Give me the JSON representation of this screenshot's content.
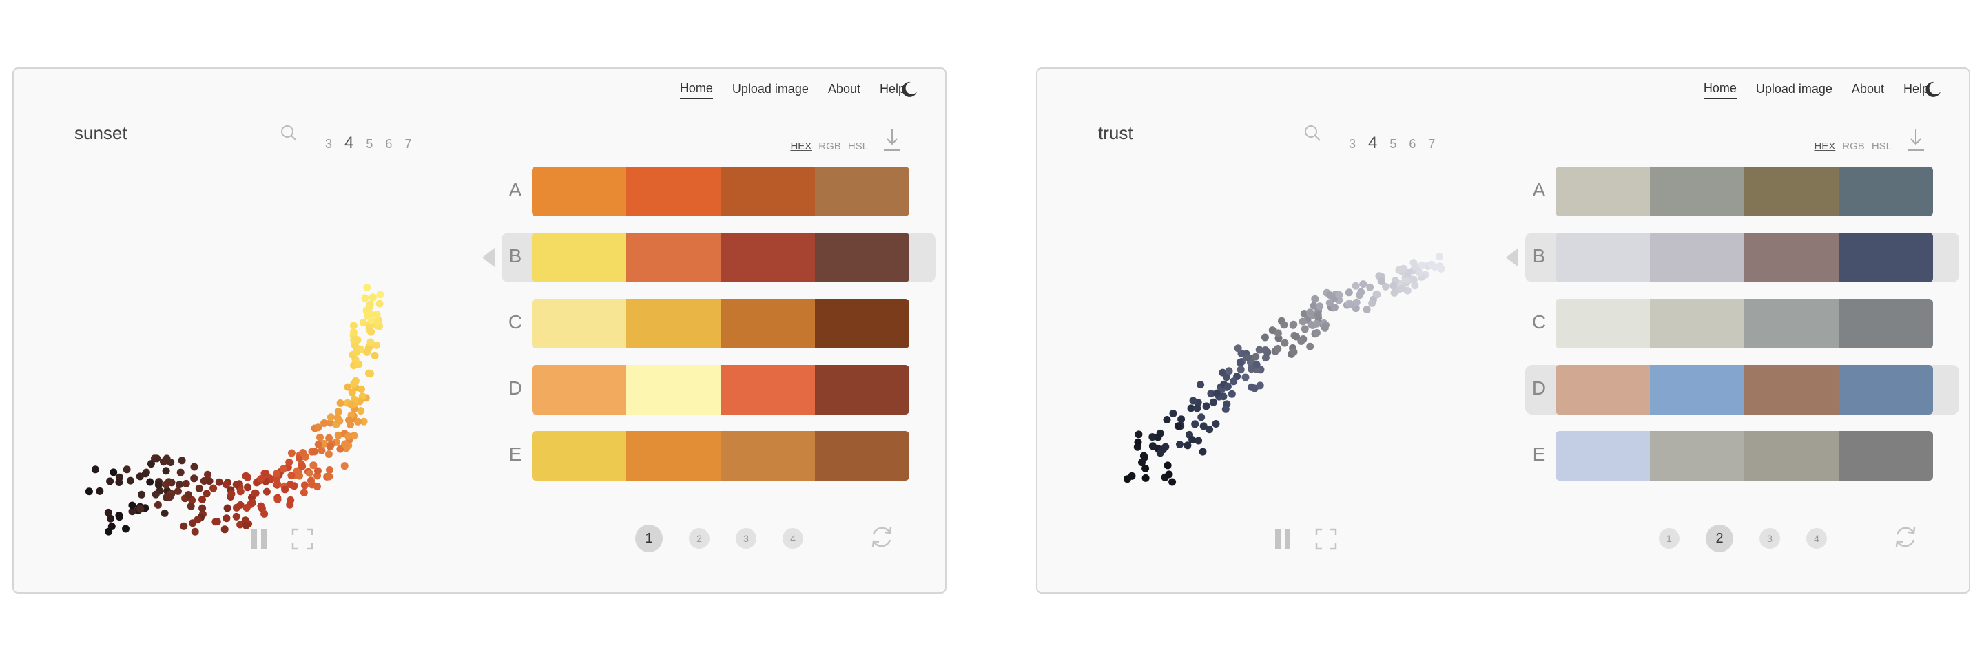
{
  "nav": [
    "Home",
    "Upload image",
    "About",
    "Help"
  ],
  "count_options": [
    "3",
    "4",
    "5",
    "6",
    "7"
  ],
  "format_options": [
    "HEX",
    "RGB",
    "HSL"
  ],
  "icons": {
    "search": "search-icon",
    "download": "download-icon",
    "moon": "moon-icon",
    "pause": "pause-icon",
    "fullscreen": "fullscreen-icon",
    "refresh": "refresh-icon"
  },
  "cards": [
    {
      "search_value": "sunset",
      "selected_count": "4",
      "selected_format": "HEX",
      "selected_palette": "B",
      "page_numbers": [
        "1",
        "2",
        "3",
        "4"
      ],
      "active_page": "1",
      "palettes": [
        {
          "letter": "A",
          "colors": [
            "#E88A33",
            "#E0622C",
            "#B95A29",
            "#AA7346"
          ]
        },
        {
          "letter": "B",
          "colors": [
            "#F4DC63",
            "#DC7141",
            "#A64331",
            "#6E4338"
          ]
        },
        {
          "letter": "C",
          "colors": [
            "#F7E594",
            "#E9B544",
            "#C57730",
            "#7A3C1B"
          ]
        },
        {
          "letter": "D",
          "colors": [
            "#F1AA5E",
            "#FDF6B1",
            "#E36A43",
            "#8B402B"
          ]
        },
        {
          "letter": "E",
          "colors": [
            "#EEC94F",
            "#E28E37",
            "#C88341",
            "#9E5C32"
          ]
        }
      ]
    },
    {
      "search_value": "trust",
      "selected_count": "4",
      "selected_format": "HEX",
      "selected_palette": "B",
      "page_numbers": [
        "1",
        "2",
        "3",
        "4"
      ],
      "active_page": "2",
      "palettes": [
        {
          "letter": "A",
          "colors": [
            "#C7C5B8",
            "#979B93",
            "#827556",
            "#5E6F7A"
          ]
        },
        {
          "letter": "B",
          "colors": [
            "#D8D9DF",
            "#C0BFC8",
            "#8E7876",
            "#47516C"
          ]
        },
        {
          "letter": "C",
          "colors": [
            "#E1E2D9",
            "#C9C8BC",
            "#9EA3A1",
            "#808385"
          ]
        },
        {
          "letter": "D",
          "colors": [
            "#D1A891",
            "#84A6CE",
            "#9F7864",
            "#6B86A6"
          ]
        },
        {
          "letter": "E",
          "colors": [
            "#C3CDE3",
            "#B0AFA7",
            "#A19F94",
            "#7E7F7E"
          ]
        }
      ]
    }
  ]
}
